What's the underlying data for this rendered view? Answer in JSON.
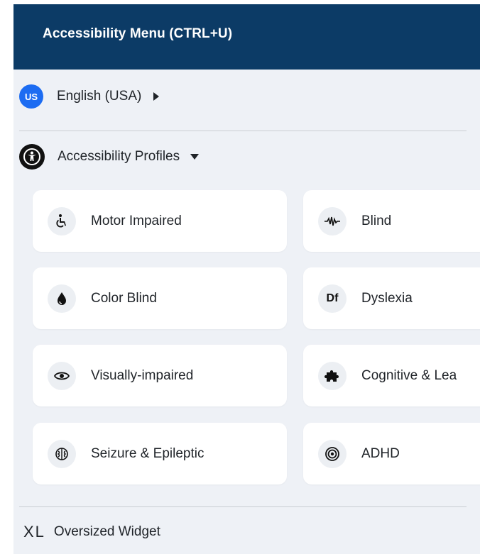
{
  "header": {
    "title": "Accessibility Menu (CTRL+U)"
  },
  "language": {
    "flag_code": "US",
    "label": "English (USA)"
  },
  "profiles": {
    "heading": "Accessibility Profiles",
    "items": [
      {
        "label": "Motor Impaired",
        "icon": "wheelchair-icon"
      },
      {
        "label": "Blind",
        "icon": "audio-wave-icon"
      },
      {
        "label": "Color Blind",
        "icon": "droplet-icon"
      },
      {
        "label": "Dyslexia",
        "icon": "df-text-icon",
        "icon_text": "Df"
      },
      {
        "label": "Visually-impaired",
        "icon": "eye-icon"
      },
      {
        "label": "Cognitive & Lea",
        "icon": "puzzle-icon"
      },
      {
        "label": "Seizure & Epileptic",
        "icon": "brain-icon"
      },
      {
        "label": "ADHD",
        "icon": "target-icon"
      }
    ]
  },
  "oversized": {
    "glyph": "XL",
    "label": "Oversized Widget"
  },
  "colors": {
    "header_bg": "#0c3b66",
    "panel_bg": "#eef1f6",
    "flag_bg": "#1c6cf2"
  }
}
